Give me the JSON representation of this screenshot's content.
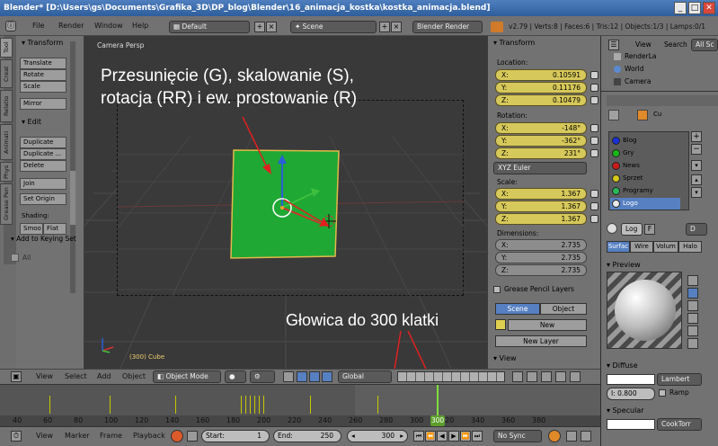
{
  "window": {
    "title": "Blender* [D:\\Users\\gs\\Documents\\Grafika_3D\\DP_blog\\Blender\\16_animacja_kostka\\kostka_animacja.blend]",
    "min": "_",
    "max": "□",
    "close": "✕"
  },
  "menubar": {
    "items": [
      "File",
      "Render",
      "Window",
      "Help"
    ],
    "layout": "Default",
    "scene": "Scene",
    "engine": "Blender Render",
    "stats": "v2.79 | Verts:8 | Faces:6 | Tris:12 | Objects:1/3 | Lamps:0/1"
  },
  "left_tabs": [
    "Tool",
    "Creat",
    "Relatio",
    "Animati",
    "Phys",
    "Grease Pen"
  ],
  "toolshelf": {
    "transform_header": "▾ Transform",
    "transform_buttons": [
      "Translate",
      "Rotate",
      "Scale"
    ],
    "mirror": "Mirror",
    "edit_header": "▾ Edit",
    "edit_buttons": [
      "Duplicate",
      "Duplicate ...",
      "Delete"
    ],
    "join": "Join",
    "set_origin": "Set Origin",
    "shading_label": "Shading:",
    "smooth": "Smoo",
    "flat": "Flat",
    "keying_header": "▾ Add to Keying Set",
    "all": "All"
  },
  "viewport": {
    "camera_label": "Camera Persp",
    "object_label": "(300) Cube",
    "overlay_line1": "Przesunięcie (G), skalowanie (S),",
    "overlay_line2": "rotacja (RR) i ew. prostowanie (R)",
    "annotation_playhead": "Głowica do 300 klatki"
  },
  "npanel": {
    "transform_header": "▾ Transform",
    "location_label": "Location:",
    "location": [
      {
        "axis": "X:",
        "value": "0.10591"
      },
      {
        "axis": "Y:",
        "value": "0.11176"
      },
      {
        "axis": "Z:",
        "value": "0.10479"
      }
    ],
    "rotation_label": "Rotation:",
    "rotation": [
      {
        "axis": "X:",
        "value": "-148°"
      },
      {
        "axis": "Y:",
        "value": "-362°"
      },
      {
        "axis": "Z:",
        "value": "231°"
      }
    ],
    "rotation_mode": "XYZ Euler",
    "scale_label": "Scale:",
    "scale": [
      {
        "axis": "X:",
        "value": "1.367"
      },
      {
        "axis": "Y:",
        "value": "1.367"
      },
      {
        "axis": "Z:",
        "value": "1.367"
      }
    ],
    "dimensions_label": "Dimensions:",
    "dimensions": [
      {
        "axis": "X:",
        "value": "2.735"
      },
      {
        "axis": "Y:",
        "value": "2.735"
      },
      {
        "axis": "Z:",
        "value": "2.735"
      }
    ],
    "grease_header": "Grease Pencil Layers",
    "scene_tab": "Scene",
    "object_tab": "Object",
    "new": "New",
    "new_layer": "New Layer",
    "view_header": "▾ View"
  },
  "outliner": {
    "view": "View",
    "search": "Search",
    "all_scenes": "All Sc",
    "items": [
      "RenderLa",
      "World",
      "Camera"
    ]
  },
  "properties": {
    "object_name": "Cu",
    "materials": [
      {
        "name": "Blog",
        "color": "#1a2fd6"
      },
      {
        "name": "Gry",
        "color": "#18b818"
      },
      {
        "name": "News",
        "color": "#cc1a1a"
      },
      {
        "name": "Sprzet",
        "color": "#d6c81a"
      },
      {
        "name": "Programy",
        "color": "#2ab85a"
      },
      {
        "name": "Logo",
        "color": "#e8e8e8"
      }
    ],
    "material_name": "Log",
    "f_label": "F",
    "d_label": "D",
    "tabs": [
      "Surfac",
      "Wire",
      "Volum",
      "Halo"
    ],
    "preview_header": "▾ Preview",
    "diffuse_header": "▾ Diffuse",
    "diffuse_shader": "Lambert",
    "intensity": "I: 0.800",
    "ramp": "Ramp",
    "specular_header": "▾ Specular",
    "specular_shader": "CookTorr"
  },
  "v3d_header": {
    "view": "View",
    "select": "Select",
    "add": "Add",
    "object": "Object",
    "mode": "Object Mode",
    "orientation": "Global"
  },
  "timeline": {
    "ruler_ticks": [
      "40",
      "60",
      "80",
      "100",
      "120",
      "140",
      "160",
      "180",
      "200",
      "220",
      "240",
      "260",
      "280",
      "300",
      "320",
      "340",
      "360",
      "380"
    ],
    "current_frame": 300,
    "view": "View",
    "marker": "Marker",
    "frame": "Frame",
    "playback": "Playback",
    "start": "Start:",
    "start_val": "1",
    "end": "End:",
    "end_val": "250",
    "frame_val": "300",
    "sync": "No Sync"
  }
}
